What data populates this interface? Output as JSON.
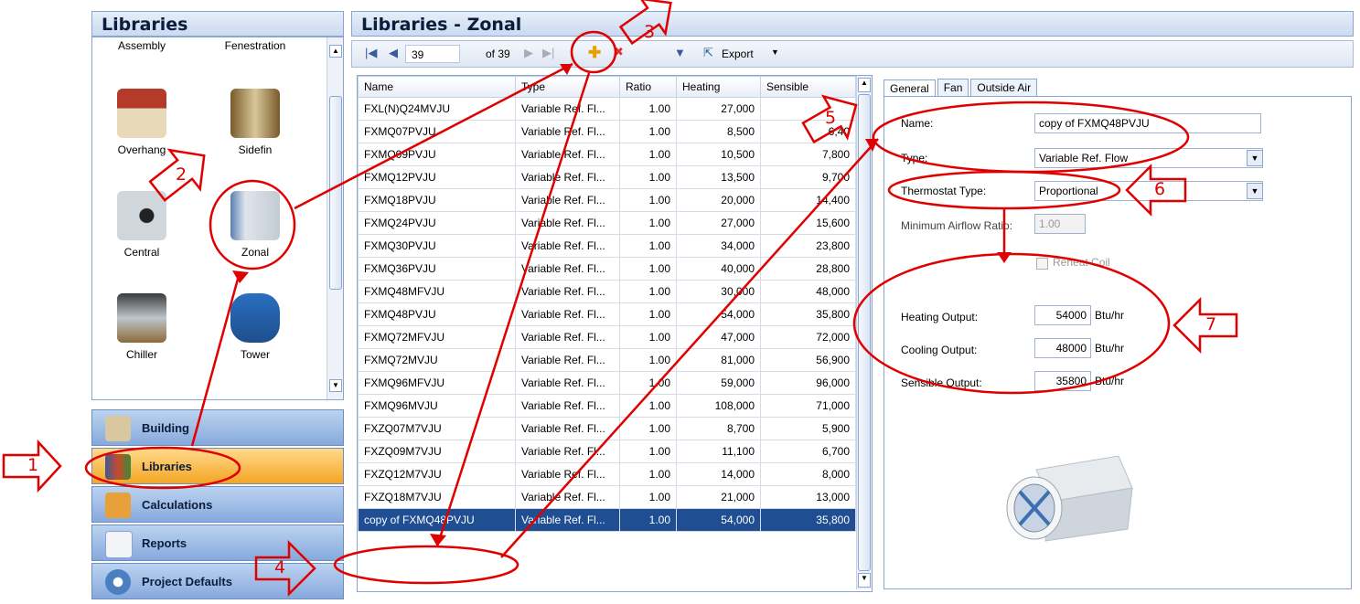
{
  "left_header": "Libraries",
  "right_header": "Libraries - Zonal",
  "library_items": [
    {
      "label": "Assembly",
      "icon": "assembly-icon"
    },
    {
      "label": "Fenestration",
      "icon": "fenestration-icon"
    },
    {
      "label": "Overhang",
      "icon": "overhang-icon"
    },
    {
      "label": "Sidefin",
      "icon": "sidefin-icon"
    },
    {
      "label": "Central",
      "icon": "central-icon"
    },
    {
      "label": "Zonal",
      "icon": "zonal-icon"
    },
    {
      "label": "Chiller",
      "icon": "chiller-icon"
    },
    {
      "label": "Tower",
      "icon": "tower-icon"
    }
  ],
  "nav": [
    "Building",
    "Libraries",
    "Calculations",
    "Reports",
    "Project Defaults"
  ],
  "toolbar": {
    "record": "39",
    "of": "of 39",
    "export": "Export"
  },
  "grid": {
    "headers": [
      "Name",
      "Type",
      "Ratio",
      "Heating",
      "Sensible"
    ],
    "rows": [
      [
        "FXL(N)Q24MVJU",
        "Variable Ref. Fl...",
        "1.00",
        "27,000",
        ""
      ],
      [
        "FXMQ07PVJU",
        "Variable Ref. Fl...",
        "1.00",
        "8,500",
        "6,40"
      ],
      [
        "FXMQ09PVJU",
        "Variable Ref. Fl...",
        "1.00",
        "10,500",
        "7,800"
      ],
      [
        "FXMQ12PVJU",
        "Variable Ref. Fl...",
        "1.00",
        "13,500",
        "9,700"
      ],
      [
        "FXMQ18PVJU",
        "Variable Ref. Fl...",
        "1.00",
        "20,000",
        "14,400"
      ],
      [
        "FXMQ24PVJU",
        "Variable Ref. Fl...",
        "1.00",
        "27,000",
        "15,600"
      ],
      [
        "FXMQ30PVJU",
        "Variable Ref. Fl...",
        "1.00",
        "34,000",
        "23,800"
      ],
      [
        "FXMQ36PVJU",
        "Variable Ref. Fl...",
        "1.00",
        "40,000",
        "28,800"
      ],
      [
        "FXMQ48MFVJU",
        "Variable Ref. Fl...",
        "1.00",
        "30,000",
        "48,000"
      ],
      [
        "FXMQ48PVJU",
        "Variable Ref. Fl...",
        "1.00",
        "54,000",
        "35,800"
      ],
      [
        "FXMQ72MFVJU",
        "Variable Ref. Fl...",
        "1.00",
        "47,000",
        "72,000"
      ],
      [
        "FXMQ72MVJU",
        "Variable Ref. Fl...",
        "1.00",
        "81,000",
        "56,900"
      ],
      [
        "FXMQ96MFVJU",
        "Variable Ref. Fl...",
        "1.00",
        "59,000",
        "96,000"
      ],
      [
        "FXMQ96MVJU",
        "Variable Ref. Fl...",
        "1.00",
        "108,000",
        "71,000"
      ],
      [
        "FXZQ07M7VJU",
        "Variable Ref. Fl...",
        "1.00",
        "8,700",
        "5,900"
      ],
      [
        "FXZQ09M7VJU",
        "Variable Ref. Fl...",
        "1.00",
        "11,100",
        "6,700"
      ],
      [
        "FXZQ12M7VJU",
        "Variable Ref. Fl...",
        "1.00",
        "14,000",
        "8,000"
      ],
      [
        "FXZQ18M7VJU",
        "Variable Ref. Fl...",
        "1.00",
        "21,000",
        "13,000"
      ],
      [
        "copy of FXMQ48PVJU",
        "Variable Ref. Fl...",
        "1.00",
        "54,000",
        "35,800"
      ]
    ]
  },
  "tabs": [
    "General",
    "Fan",
    "Outside Air"
  ],
  "form": {
    "name_label": "Name:",
    "name_value": "copy of FXMQ48PVJU",
    "type_label": "Type:",
    "type_value": "Variable Ref. Flow",
    "thermostat_label": "Thermostat Type:",
    "thermostat_value": "Proportional",
    "min_airflow_label": "Minimum Airflow Ratio:",
    "min_airflow_value": "1.00",
    "reheat_label": "Reheat Coil",
    "heating_label": "Heating Output:",
    "heating_value": "54000",
    "cooling_label": "Cooling Output:",
    "cooling_value": "48000",
    "sensible_label": "Sensible Output:",
    "sensible_value": "35800",
    "unit": "Btu/hr"
  },
  "annotations": [
    "1",
    "2",
    "3",
    "4",
    "5",
    "6",
    "7"
  ],
  "colors": {
    "annotation": "#e00000",
    "selected_row": "#1f4e93",
    "active_nav": "#f4a623"
  }
}
